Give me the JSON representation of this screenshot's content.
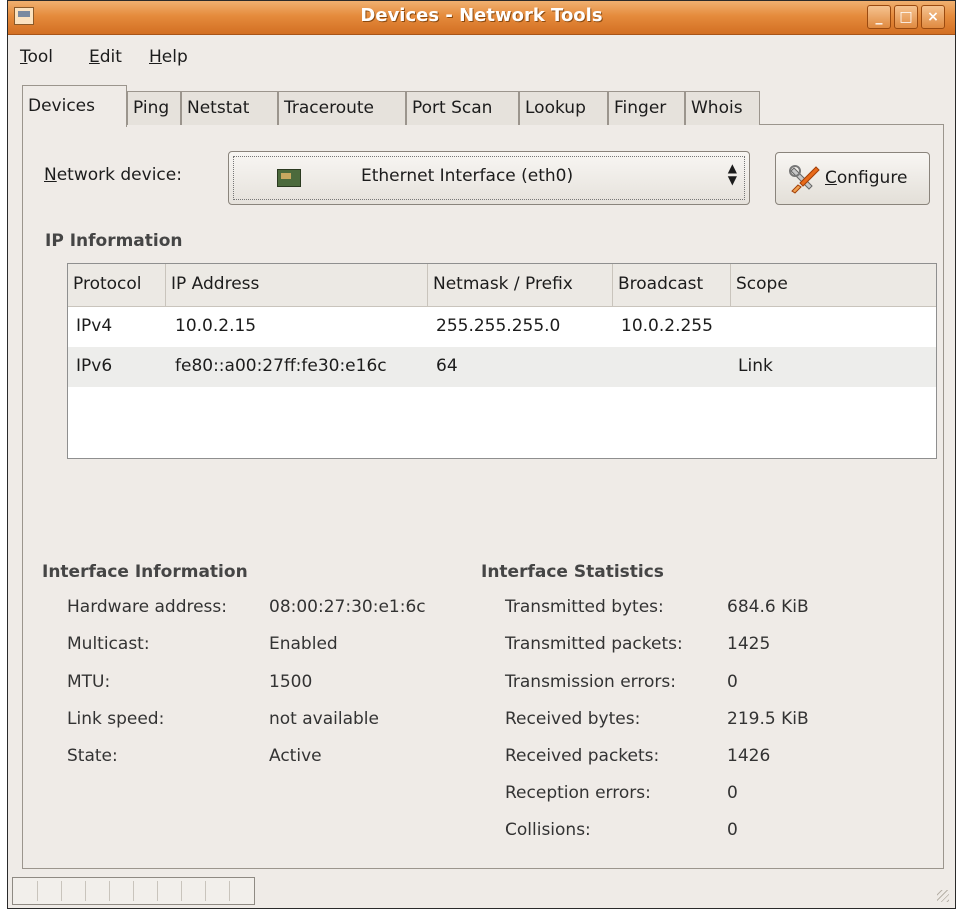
{
  "window": {
    "title": "Devices - Network Tools",
    "controls": [
      "_",
      "□",
      "×"
    ]
  },
  "menubar": [
    {
      "label": "Tool",
      "mnemonic": "T",
      "rest": "ool"
    },
    {
      "label": "Edit",
      "mnemonic": "E",
      "rest": "dit"
    },
    {
      "label": "Help",
      "mnemonic": "H",
      "rest": "elp"
    }
  ],
  "tabs": [
    "Devices",
    "Ping",
    "Netstat",
    "Traceroute",
    "Port Scan",
    "Lookup",
    "Finger",
    "Whois"
  ],
  "active_tab": "Devices",
  "device": {
    "label_mnemonic": "N",
    "label_rest": "etwork device:",
    "selected": "Ethernet Interface (eth0)",
    "icon": "network-card-icon",
    "configure_mnemonic": "C",
    "configure_rest": "onfigure"
  },
  "ip_info": {
    "title": "IP Information",
    "columns": [
      "Protocol",
      "IP Address",
      "Netmask / Prefix",
      "Broadcast",
      "Scope"
    ],
    "rows": [
      [
        "IPv4",
        "10.0.2.15",
        "255.255.255.0",
        "10.0.2.255",
        ""
      ],
      [
        "IPv6",
        "fe80::a00:27ff:fe30:e16c",
        "64",
        "",
        "Link"
      ]
    ]
  },
  "interface_info": {
    "title": "Interface Information",
    "rows": [
      {
        "label": "Hardware address:",
        "value": "08:00:27:30:e1:6c"
      },
      {
        "label": "Multicast:",
        "value": "Enabled"
      },
      {
        "label": "MTU:",
        "value": "1500"
      },
      {
        "label": "Link speed:",
        "value": "not available"
      },
      {
        "label": "State:",
        "value": "Active"
      }
    ]
  },
  "interface_stats": {
    "title": "Interface Statistics",
    "rows": [
      {
        "label": "Transmitted bytes:",
        "value": "684.6 KiB"
      },
      {
        "label": "Transmitted packets:",
        "value": "1425"
      },
      {
        "label": "Transmission errors:",
        "value": "0"
      },
      {
        "label": "Received bytes:",
        "value": "219.5 KiB"
      },
      {
        "label": "Received packets:",
        "value": "1426"
      },
      {
        "label": "Reception errors:",
        "value": "0"
      },
      {
        "label": "Collisions:",
        "value": "0"
      }
    ]
  }
}
